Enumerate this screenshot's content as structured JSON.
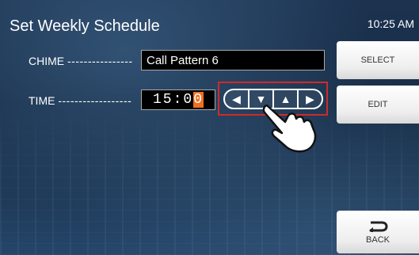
{
  "header": {
    "title": "Set Weekly Schedule",
    "clock": "10:25 AM"
  },
  "form": {
    "chime_label": "CHIME",
    "chime_dashes": "----------------",
    "chime_value": "Call Pattern 6",
    "time_label": "TIME",
    "time_dashes": "------------------",
    "time_value_main": "15:0",
    "time_value_cursor": "0"
  },
  "arrows": {
    "left": "◀",
    "down": "▼",
    "up": "▲",
    "right": "▶"
  },
  "side_buttons": {
    "select": "SELECT",
    "edit": "EDIT",
    "back": "BACK"
  },
  "colors": {
    "highlight_box": "#d02a2a",
    "cursor": "#f07020",
    "background": "#1c3350"
  }
}
